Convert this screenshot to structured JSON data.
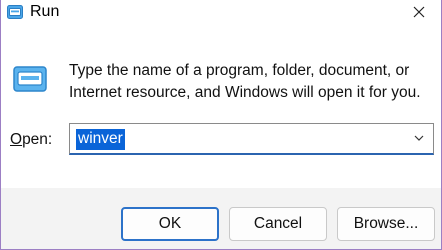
{
  "window": {
    "title": "Run"
  },
  "dialog": {
    "description": "Type the name of a program, folder, document, or Internet resource, and Windows will open it for you.",
    "open_label": "Open:",
    "open_value": "winver"
  },
  "buttons": {
    "ok": "OK",
    "cancel": "Cancel",
    "browse": "Browse..."
  },
  "icons": {
    "title": "run-icon",
    "dialog": "run-icon",
    "close": "close-icon",
    "dropdown": "chevron-down-icon"
  },
  "colors": {
    "selection": "#0a64d8",
    "accent_border": "#2c72c9",
    "window_border": "#9c7fc4"
  }
}
